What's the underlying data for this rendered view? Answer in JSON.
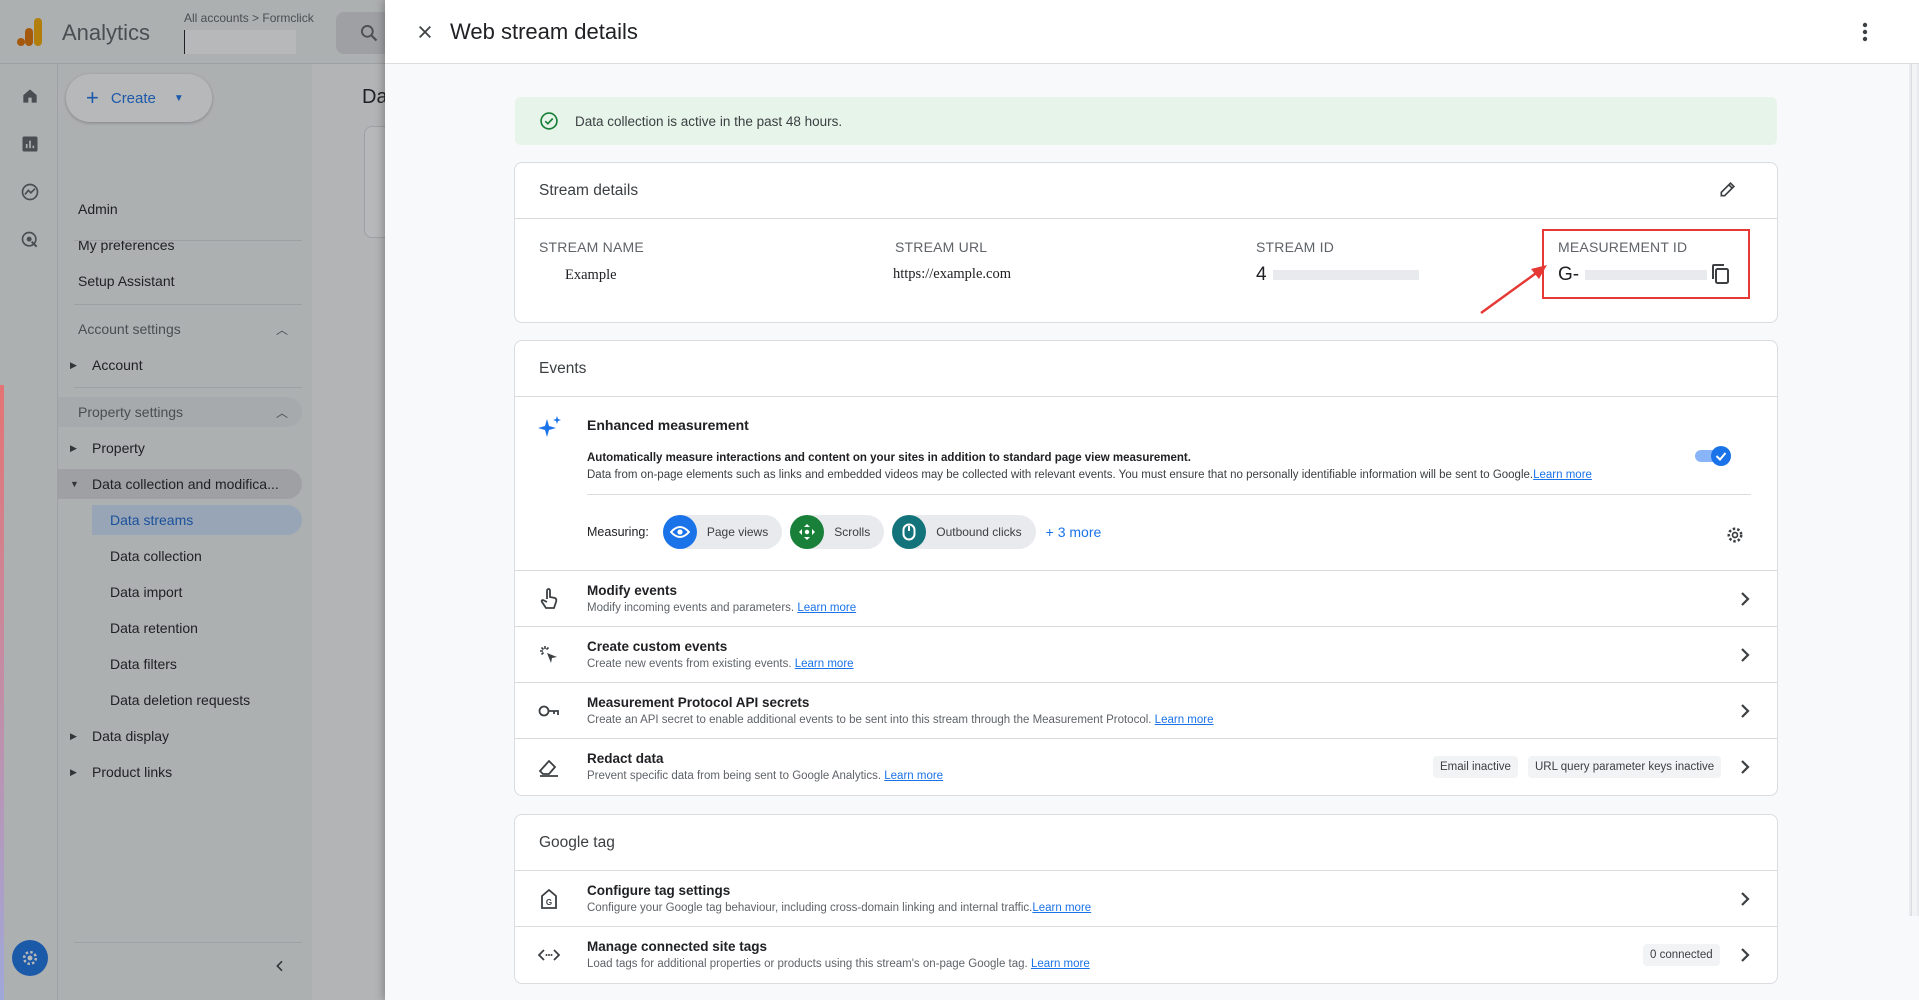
{
  "app": {
    "name": "Analytics",
    "account_crumb": "All accounts > Formclick",
    "account_select_value": "|"
  },
  "sidebar": {
    "create_label": "Create",
    "top_items": [
      "Admin",
      "My preferences",
      "Setup Assistant"
    ],
    "account_settings_label": "Account settings",
    "account_item": "Account",
    "property_settings_label": "Property settings",
    "property_item": "Property",
    "data_collection_item": "Data collection and modifica...",
    "sub_items": [
      "Data streams",
      "Data collection",
      "Data import",
      "Data retention",
      "Data filters",
      "Data deletion requests"
    ],
    "data_display_item": "Data display",
    "product_links_item": "Product links"
  },
  "background": {
    "page_title_partial": "Da"
  },
  "panel": {
    "title": "Web stream details",
    "banner_text": "Data collection is active in the past 48 hours.",
    "stream_details": {
      "heading": "Stream details",
      "stream_name_label": "STREAM NAME",
      "stream_name_value": "Example",
      "stream_url_label": "STREAM URL",
      "stream_url_value": "https://example.com",
      "stream_id_label": "STREAM ID",
      "stream_id_value": "4",
      "measurement_id_label": "MEASUREMENT ID",
      "measurement_id_value": "G-"
    },
    "events": {
      "heading": "Events",
      "enhanced": {
        "title": "Enhanced measurement",
        "desc1": "Automatically measure interactions and content on your sites in addition to standard page view measurement.",
        "desc2": "Data from on-page elements such as links and embedded videos may be collected with relevant events. You must ensure that no personally identifiable information will be sent to Google.",
        "learn_more": "Learn more",
        "toggle_on": true,
        "measuring_label": "Measuring:",
        "chips": [
          "Page views",
          "Scrolls",
          "Outbound clicks"
        ],
        "more_label": "+ 3 more"
      },
      "rows": [
        {
          "title": "Modify events",
          "desc": "Modify incoming events and parameters.",
          "link": "Learn more"
        },
        {
          "title": "Create custom events",
          "desc": "Create new events from existing events.",
          "link": "Learn more"
        },
        {
          "title": "Measurement Protocol API secrets",
          "desc": "Create an API secret to enable additional events to be sent into this stream through the Measurement Protocol.",
          "link": "Learn more"
        },
        {
          "title": "Redact data",
          "desc": "Prevent specific data from being sent to Google Analytics.",
          "link": "Learn more",
          "tags": [
            "Email inactive",
            "URL query parameter keys inactive"
          ]
        }
      ]
    },
    "google_tag": {
      "heading": "Google tag",
      "rows": [
        {
          "title": "Configure tag settings",
          "desc": "Configure your Google tag behaviour, including cross-domain linking and internal traffic.",
          "link": "Learn more"
        },
        {
          "title": "Manage connected site tags",
          "desc": "Load tags for additional properties or products using this stream's on-page Google tag.",
          "link": "Learn more",
          "tag": "0 connected"
        }
      ]
    }
  },
  "colors": {
    "accent": "#1a73e8",
    "highlight": "#e53935",
    "success_bg": "#e6f4ea",
    "success_icon": "#188038"
  }
}
